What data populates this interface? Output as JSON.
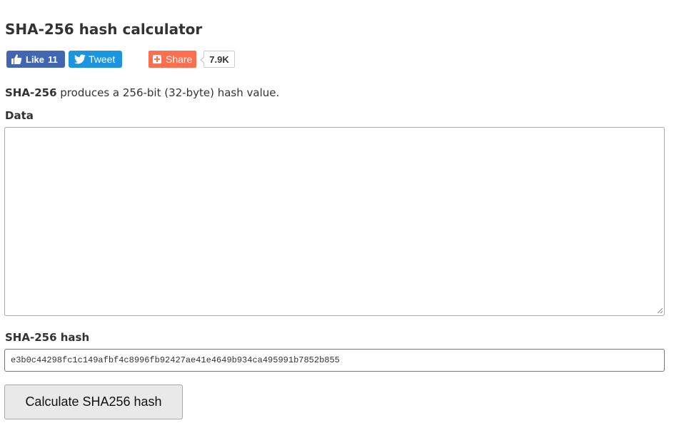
{
  "page": {
    "title": "SHA-256 hash calculator"
  },
  "social": {
    "like_label": "Like",
    "like_count": "11",
    "tweet_label": "Tweet",
    "share_label": "Share",
    "share_count": "7.9K",
    "colors": {
      "facebook": "#4267b2",
      "twitter": "#1b95e0",
      "share": "#ff6e4f"
    },
    "icons": {
      "like": "thumbs-up-icon",
      "tweet": "twitter-bird-icon",
      "share": "plus-square-icon"
    }
  },
  "description": {
    "algorithm": "SHA-256",
    "text": " produces a 256-bit (32-byte) hash value."
  },
  "data_field": {
    "label": "Data",
    "value": ""
  },
  "hash_field": {
    "label": "SHA-256 hash",
    "value": "e3b0c44298fc1c149afbf4c8996fb92427ae41e4649b934ca495991b7852b855"
  },
  "calculate_button": {
    "label": "Calculate SHA256 hash"
  }
}
